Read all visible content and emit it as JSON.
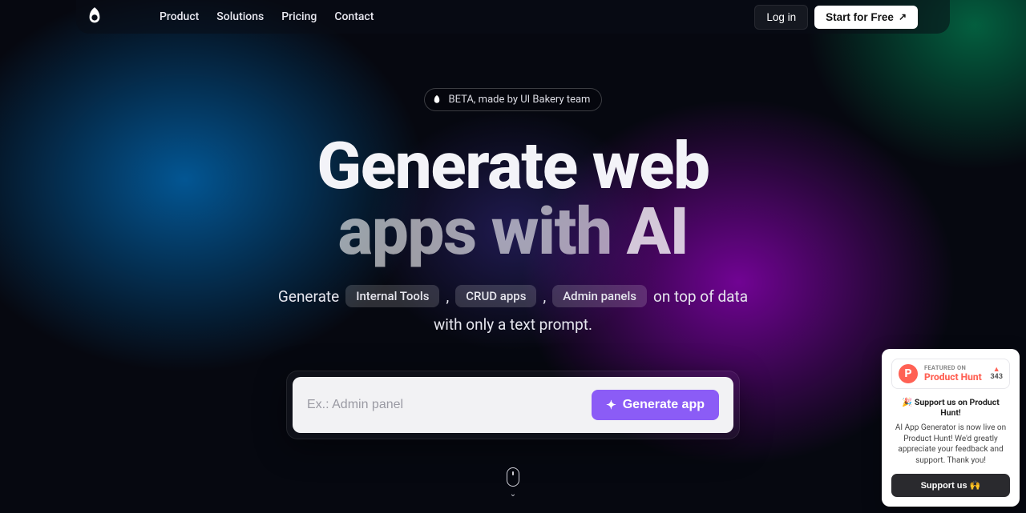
{
  "nav": {
    "items": [
      "Product",
      "Solutions",
      "Pricing",
      "Contact"
    ],
    "login": "Log in",
    "cta": "Start for Free"
  },
  "hero": {
    "beta": "BETA, made by UI Bakery team",
    "title_line1": "Generate web",
    "title_line2a": "apps with ",
    "title_line2b": "AI",
    "sub_generate": "Generate",
    "chips": [
      "Internal Tools",
      "CRUD apps",
      "Admin panels"
    ],
    "sub_tail": "on top of data",
    "sub_line2": "with only a text prompt.",
    "placeholder": "Ex.: Admin panel",
    "gen_label": "Generate app"
  },
  "ph": {
    "featured": "FEATURED ON",
    "name": "Product Hunt",
    "upvotes": "343",
    "title": "🎉 Support us on Product Hunt!",
    "desc": "AI App Generator is now live on Product Hunt! We'd greatly appreciate your feedback and support. Thank you!",
    "cta": "Support us 🙌"
  }
}
